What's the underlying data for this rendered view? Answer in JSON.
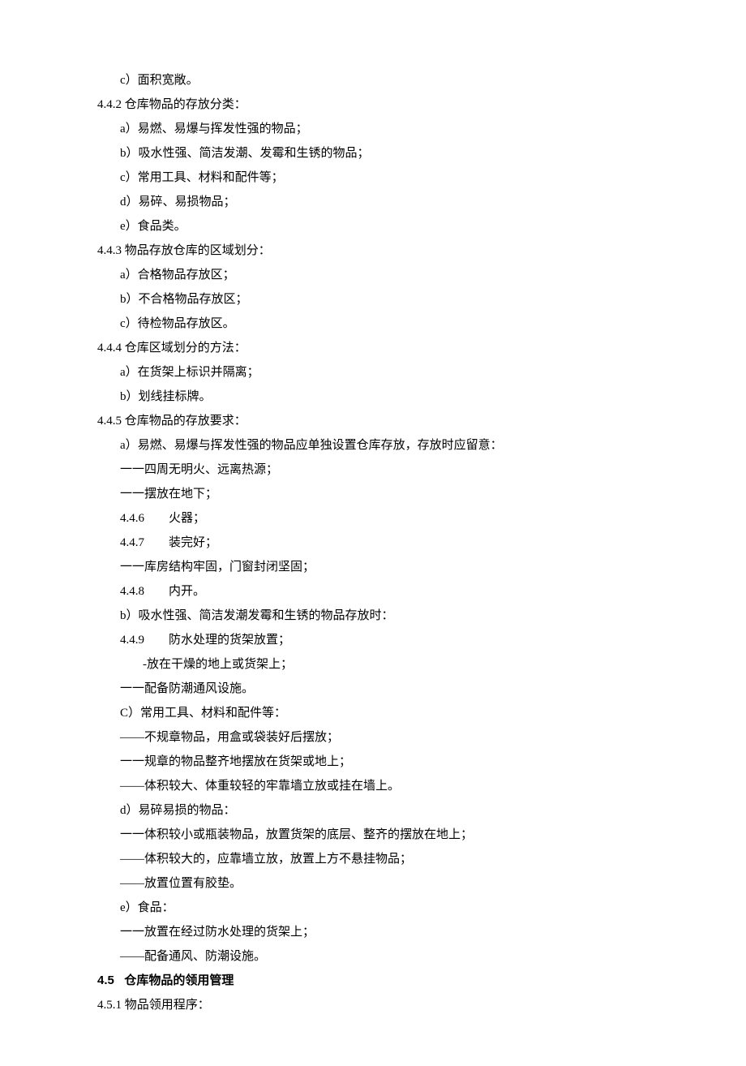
{
  "lines": [
    {
      "indent": 2,
      "bold": false,
      "text": "c）面积宽敞。"
    },
    {
      "indent": 1,
      "bold": false,
      "text": "4.4.2 仓库物品的存放分类："
    },
    {
      "indent": 2,
      "bold": false,
      "text": "a）易燃、易爆与挥发性强的物品；"
    },
    {
      "indent": 2,
      "bold": false,
      "text": "b）吸水性强、简洁发潮、发霉和生锈的物品；"
    },
    {
      "indent": 2,
      "bold": false,
      "text": "c）常用工具、材料和配件等；"
    },
    {
      "indent": 2,
      "bold": false,
      "text": "d）易碎、易损物品；"
    },
    {
      "indent": 2,
      "bold": false,
      "text": "e）食品类。"
    },
    {
      "indent": 1,
      "bold": false,
      "text": "4.4.3 物品存放仓库的区域划分："
    },
    {
      "indent": 2,
      "bold": false,
      "text": "a）合格物品存放区；"
    },
    {
      "indent": 2,
      "bold": false,
      "text": "b）不合格物品存放区；"
    },
    {
      "indent": 2,
      "bold": false,
      "text": "c）待检物品存放区。"
    },
    {
      "indent": 1,
      "bold": false,
      "text": "4.4.4 仓库区域划分的方法："
    },
    {
      "indent": 2,
      "bold": false,
      "text": "a）在货架上标识并隔离；"
    },
    {
      "indent": 2,
      "bold": false,
      "text": "b）划线挂标牌。"
    },
    {
      "indent": 1,
      "bold": false,
      "text": "4.4.5 仓库物品的存放要求："
    },
    {
      "indent": 2,
      "bold": false,
      "text": "a）易燃、易爆与挥发性强的物品应单独设置仓库存放，存放时应留意："
    },
    {
      "indent": 2,
      "bold": false,
      "text": "一一四周无明火、远离热源；"
    },
    {
      "indent": 2,
      "bold": false,
      "text": "一一摆放在地下；"
    },
    {
      "indent": 2,
      "bold": false,
      "text": "4.4.6        火器；"
    },
    {
      "indent": 2,
      "bold": false,
      "text": "4.4.7        装完好；"
    },
    {
      "indent": 2,
      "bold": false,
      "text": "一一库房结构牢固，门窗封闭坚固；"
    },
    {
      "indent": 2,
      "bold": false,
      "text": "4.4.8        内开。"
    },
    {
      "indent": 2,
      "bold": false,
      "text": "b）吸水性强、简洁发潮发霉和生锈的物品存放时："
    },
    {
      "indent": 2,
      "bold": false,
      "text": "4.4.9        防水处理的货架放置；"
    },
    {
      "indent": 3,
      "bold": false,
      "text": "-放在干燥的地上或货架上；"
    },
    {
      "indent": 2,
      "bold": false,
      "text": "一一配备防潮通风设施。"
    },
    {
      "indent": 2,
      "bold": false,
      "text": "C）常用工具、材料和配件等："
    },
    {
      "indent": 2,
      "bold": false,
      "text": "——不规章物品，用盒或袋装好后摆放；"
    },
    {
      "indent": 2,
      "bold": false,
      "text": "一一规章的物品整齐地摆放在货架或地上；"
    },
    {
      "indent": 2,
      "bold": false,
      "text": "——体积较大、体重较轻的牢靠墙立放或挂在墙上。"
    },
    {
      "indent": 2,
      "bold": false,
      "text": "d）易碎易损的物品："
    },
    {
      "indent": 2,
      "bold": false,
      "text": "一一体积较小或瓶装物品，放置货架的底层、整齐的摆放在地上；"
    },
    {
      "indent": 2,
      "bold": false,
      "text": "——体积较大的，应靠墙立放，放置上方不悬挂物品；"
    },
    {
      "indent": 2,
      "bold": false,
      "text": "——放置位置有胶垫。"
    },
    {
      "indent": 2,
      "bold": false,
      "text": "e）食品："
    },
    {
      "indent": 2,
      "bold": false,
      "text": "一一放置在经过防水处理的货架上；"
    },
    {
      "indent": 2,
      "bold": false,
      "text": "——配备通风、防潮设施。"
    },
    {
      "indent": 1,
      "bold": true,
      "text": "4.5   仓库物品的领用管理"
    },
    {
      "indent": 1,
      "bold": false,
      "text": "4.5.1 物品领用程序："
    }
  ]
}
